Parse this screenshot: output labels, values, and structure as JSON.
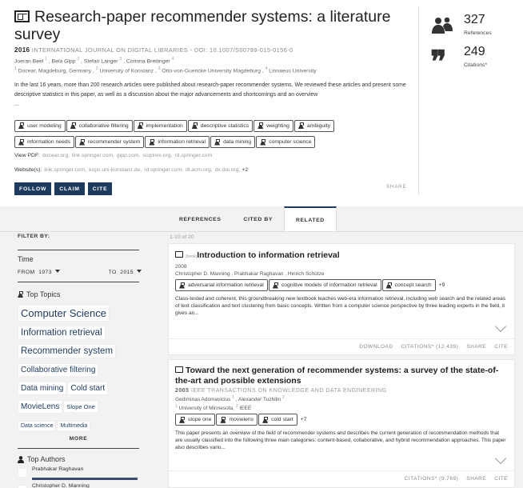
{
  "paper": {
    "title": "Research-paper recommender systems: a literature survey",
    "year": "2016",
    "venue": "INTERNATIONAL JOURNAL ON DIGITAL LIBRARIES",
    "doi": " - DOI: 10.1007/S00799-015-0156-0",
    "authors": [
      {
        "name": "Joeran Beel",
        "sup": "1"
      },
      {
        "name": "Bela Gipp",
        "sup": "2"
      },
      {
        "name": "Stefan Langer",
        "sup": "3"
      },
      {
        "name": "Corinna Breitinger",
        "sup": "4"
      }
    ],
    "affiliations": [
      {
        "sup": "1",
        "name": "Docear, Magdeburg, Germany"
      },
      {
        "sup": "2",
        "name": "University of Konstanz"
      },
      {
        "sup": "3",
        "name": "Otto-von-Guericke University Magdeburg"
      },
      {
        "sup": "4",
        "name": "Linnaeus University"
      }
    ],
    "abstract": "In the last 16 years, more than 200 research articles were published about research-paper recommender systems. We reviewed these articles and present some descriptive statistics in this paper, as well as a discussion about the major advancements and shortcomings and an overview",
    "ellipsis": "...",
    "topics_row1": [
      "user modeling",
      "collaborative filtering",
      "implementation",
      "descriptive statistics",
      "weighting",
      "ambiguity"
    ],
    "topics_row2": [
      "information needs",
      "recommender system",
      "information retrieval",
      "data mining",
      "computer science"
    ],
    "view_pdf_label": "View PDF:",
    "view_pdf_links": [
      "docear.org,",
      "link.springer.com,",
      "gipp.com,",
      "sciplore.org,",
      "rd.springer.com"
    ],
    "websites_label": "Website(s):",
    "websites_links": [
      "link.springer.com,",
      "kops.uni-konstanz.de,",
      "rd.springer.com,",
      "dl.acm.org,",
      "dx.doi.org,"
    ],
    "websites_more": "+2",
    "buttons": {
      "follow": "FOLLOW",
      "claim": "CLAIM",
      "cite": "CITE"
    },
    "share": "SHARE"
  },
  "stats": {
    "references": {
      "count": "327",
      "label": "References"
    },
    "citations": {
      "count": "249",
      "label": "Citations*"
    }
  },
  "tabs": [
    "REFERENCES",
    "CITED BY",
    "RELATED"
  ],
  "active_tab": "RELATED",
  "filter": {
    "label": "FILTER BY:",
    "time_label": "Time",
    "from_label": "FROM",
    "from_value": "1973",
    "to_label": "TO",
    "to_value": "2015",
    "top_topics_label": "Top Topics",
    "topic_rows": [
      [
        {
          "t": "Computer Science",
          "s": "13px"
        }
      ],
      [
        {
          "t": "Information retrieval",
          "s": "11.5px"
        }
      ],
      [
        {
          "t": "Recommender system",
          "s": "11.5px"
        }
      ],
      [
        {
          "t": "Collaborative filtering",
          "s": "10px"
        }
      ],
      [
        {
          "t": "Data mining",
          "s": "10px"
        },
        {
          "t": "Cold start",
          "s": "10px"
        }
      ],
      [
        {
          "t": "MovieLens",
          "s": "10px"
        },
        {
          "t": "Slope One",
          "s": "7.5px"
        }
      ],
      [
        {
          "t": "Data science",
          "s": "7px"
        },
        {
          "t": "Multimedia",
          "s": "7px"
        }
      ]
    ],
    "more": "MORE",
    "top_authors_label": "Top Authors",
    "authors": [
      "Prabhakar Raghavan",
      "Christopher D. Manning"
    ]
  },
  "results": {
    "count_text": "1-10 of 20",
    "items": [
      {
        "type_badge": "(book)",
        "title": "Introduction to information retrieval",
        "year": "2008",
        "authors": "Christopher D. Manning ,  Prabhakar Raghavan ,  Hinrich Schütze",
        "tags": [
          "adversarial information retrieval",
          "cognitive models of information retrieval",
          "concept search"
        ],
        "more_tags": "+9",
        "abstract": "Class-tested and coherent, this groundbreaking new textbook teaches web-era information retrieval, including web search and the related areas of text classification and text clustering from basic concepts. Written from a computer science perspective by three leading experts in the field, it gives an...",
        "actions": [
          "DOWNLOAD",
          "CITATIONS* (12,439)",
          "SHARE",
          "CITE"
        ]
      },
      {
        "title": "Toward the next generation of recommender systems: a survey of the state-of-the-art and possible extensions",
        "year": "2005",
        "venue": "IEEE TRANSACTIONS ON KNOWLEDGE AND DATA ENGINEERING",
        "authors": [
          {
            "name": "Gediminas Adomavicius",
            "sup": "1"
          },
          {
            "name": "Alexander Tuzhilin",
            "sup": "2"
          }
        ],
        "affiliations": [
          {
            "sup": "1",
            "name": "University of Minnesota,"
          },
          {
            "sup": "2",
            "name": "IEEE"
          }
        ],
        "tags": [
          "slope one",
          "movielens",
          "cold start"
        ],
        "more_tags": "+7",
        "abstract": "This paper presents an overview of the field of recommender systems and describes the current generation of recommendation methods that are usually classified into the following three main categories: content-based, collaborative, and hybrid recommendation approaches. This paper also describes vario...",
        "actions": [
          "CITATIONS* (9,769)",
          "SHARE",
          "CITE"
        ]
      }
    ]
  }
}
